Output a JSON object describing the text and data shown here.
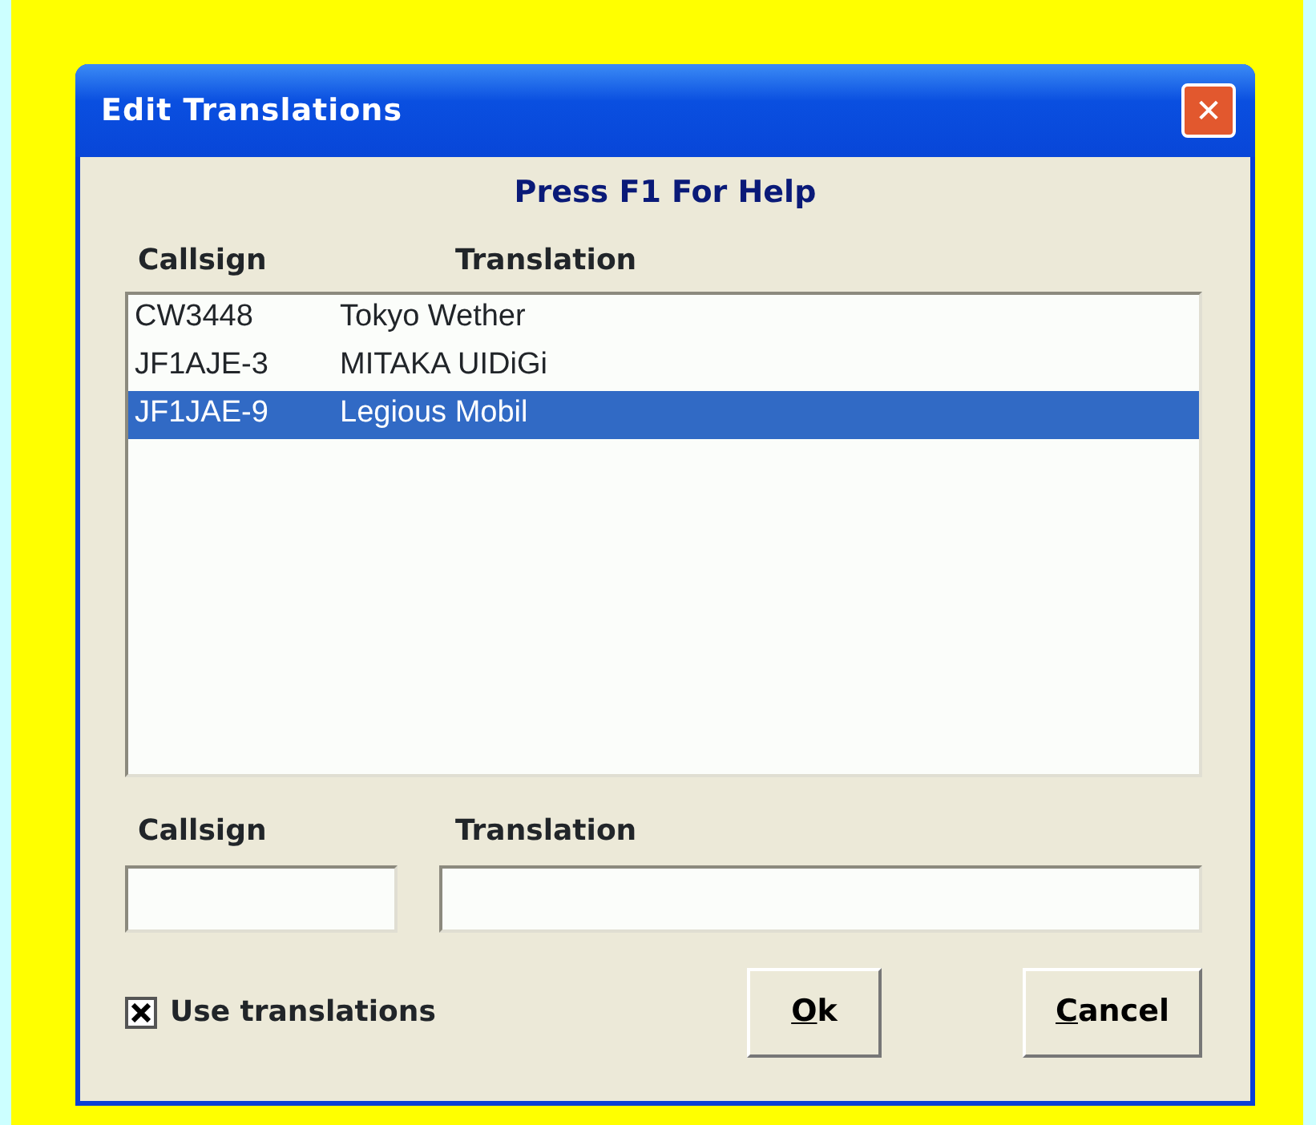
{
  "window": {
    "title": "Edit Translations",
    "close": "✕"
  },
  "help_text": "Press F1 For Help",
  "list": {
    "columns": [
      "Callsign",
      "Translation"
    ],
    "rows": [
      {
        "callsign": "CW3448",
        "translation": "Tokyo Wether",
        "selected": false
      },
      {
        "callsign": "JF1AJE-3",
        "translation": "MITAKA UIDiGi",
        "selected": false
      },
      {
        "callsign": "JF1JAE-9",
        "translation": "Legious Mobil",
        "selected": true
      }
    ]
  },
  "fields": [
    {
      "label": "Callsign"
    },
    {
      "label": "Translation"
    }
  ],
  "use_translations": {
    "label": "Use translations",
    "checked": true
  },
  "buttons": [
    {
      "mnemonic": "O",
      "rest": "k"
    },
    {
      "mnemonic": "C",
      "rest": "ancel"
    }
  ]
}
